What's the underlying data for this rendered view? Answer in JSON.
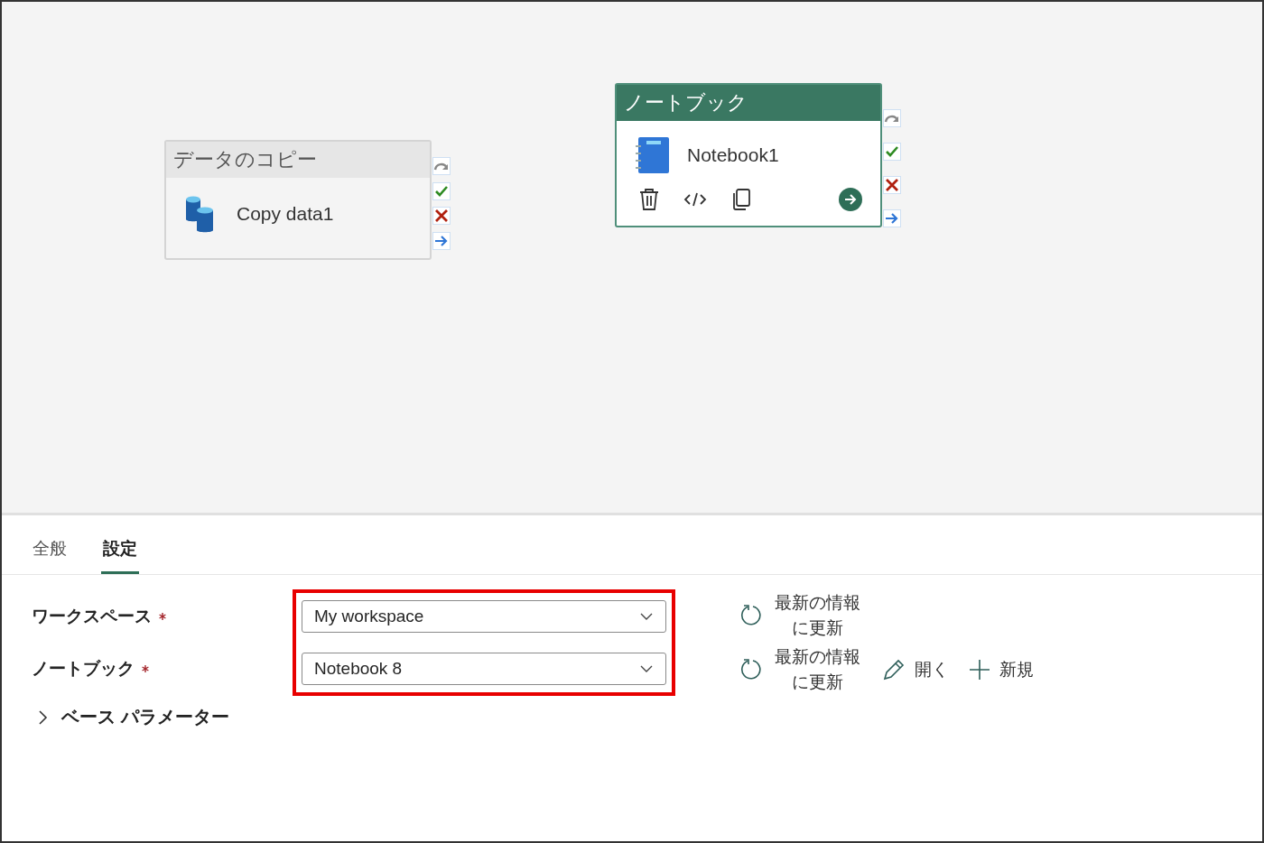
{
  "canvas": {
    "nodes": [
      {
        "kind": "copy",
        "type_label": "データのコピー",
        "name": "Copy data1",
        "selected": false
      },
      {
        "kind": "notebook",
        "type_label": "ノートブック",
        "name": "Notebook1",
        "selected": true
      }
    ]
  },
  "panel": {
    "tabs": [
      {
        "label": "全般",
        "selected": false
      },
      {
        "label": "設定",
        "selected": true
      }
    ],
    "fields": [
      {
        "label": "ワークスペース",
        "required": true,
        "value": "My workspace"
      },
      {
        "label": "ノートブック",
        "required": true,
        "value": "Notebook 8"
      }
    ],
    "fields_highlighted": true,
    "actions": [
      [
        {
          "kind": "refresh",
          "label": "最新の情報に更新"
        }
      ],
      [
        {
          "kind": "refresh",
          "label": "最新の情報に更新"
        },
        {
          "kind": "open",
          "label": "開く"
        },
        {
          "kind": "new",
          "label": "新規"
        }
      ]
    ],
    "section": {
      "label": "ベース パラメーター",
      "expanded": false
    }
  }
}
